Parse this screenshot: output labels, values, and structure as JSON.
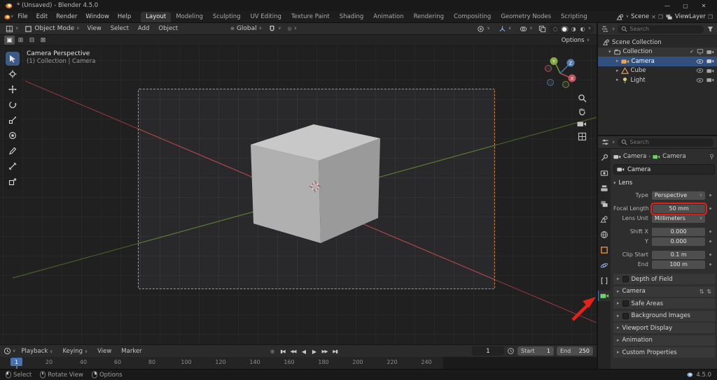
{
  "titlebar": {
    "title": "* (Unsaved) - Blender 4.5.0"
  },
  "glyphs": {
    "minimize": "—",
    "maximize": "▢",
    "close": "✕",
    "caret": "∨",
    "chevron_right": "▸",
    "chevron_down": "▾",
    "breadcrumb_sep": "›",
    "check": "✓",
    "plus": "+",
    "page": "❒",
    "unlink": "✕",
    "record": "◎",
    "skip_start": "▮◀",
    "key_prev": "◀◀",
    "play_back": "◀",
    "play": "▶",
    "key_next": "▶▶",
    "skip_end": "▶▮",
    "mode_new": "▣",
    "mode_extend": "⊞",
    "mode_subtract": "⊟",
    "mode_intersect": "⊠",
    "globe": "⊕",
    "prop_edit": "◎",
    "shade_wire": "◌",
    "shade_solid": "●",
    "shade_material": "◑",
    "shade_render": "◐",
    "preset_arrows": "⇅",
    "anim_dot": "●"
  },
  "menubar": {
    "menus": [
      "File",
      "Edit",
      "Render",
      "Window",
      "Help"
    ],
    "workspaces": [
      "Layout",
      "Modeling",
      "Sculpting",
      "UV Editing",
      "Texture Paint",
      "Shading",
      "Animation",
      "Rendering",
      "Compositing",
      "Geometry Nodes",
      "Scripting"
    ],
    "scene_label": "Scene",
    "viewlayer_label": "ViewLayer"
  },
  "viewport": {
    "header": {
      "mode": "Object Mode",
      "menus": [
        "View",
        "Select",
        "Add",
        "Object"
      ],
      "orientation": "Global"
    },
    "tool_settings": {
      "options_label": "Options"
    },
    "overlay": {
      "view_name": "Camera Perspective",
      "context": "(1) Collection | Camera"
    },
    "gizmo_axes": [
      "X",
      "Y",
      "Z"
    ]
  },
  "outliner": {
    "search_placeholder": "Search",
    "scene_collection": "Scene Collection",
    "collection": "Collection",
    "objects": [
      "Camera",
      "Cube",
      "Light"
    ]
  },
  "properties": {
    "search_placeholder": "Search",
    "breadcrumb_object": "Camera",
    "breadcrumb_data": "Camera",
    "name_value": "Camera",
    "lens_section": "Lens",
    "rows": {
      "type_label": "Type",
      "type_value": "Perspective",
      "focal_label": "Focal Length",
      "focal_value": "50 mm",
      "unit_label": "Lens Unit",
      "unit_value": "Millimeters",
      "shift_x_label": "Shift X",
      "shift_x_value": "0.000",
      "shift_y_label": "Y",
      "shift_y_value": "0.000",
      "clip_start_label": "Clip Start",
      "clip_start_value": "0.1 m",
      "clip_end_label": "End",
      "clip_end_value": "100 m"
    },
    "sections": [
      "Depth of Field",
      "Camera",
      "Safe Areas",
      "Background Images",
      "Viewport Display",
      "Animation",
      "Custom Properties"
    ]
  },
  "timeline": {
    "menus": [
      "Playback",
      "Keying",
      "View",
      "Marker"
    ],
    "current_frame": "1",
    "start_label": "Start",
    "start_value": "1",
    "end_label": "End",
    "end_value": "250",
    "playhead_label": "1",
    "ticks": [
      "20",
      "40",
      "60",
      "80",
      "100",
      "120",
      "140",
      "160",
      "180",
      "200",
      "220",
      "240"
    ]
  },
  "statusbar": {
    "hints": [
      "Select",
      "Rotate View",
      "Options"
    ],
    "version": "4.5.0"
  }
}
